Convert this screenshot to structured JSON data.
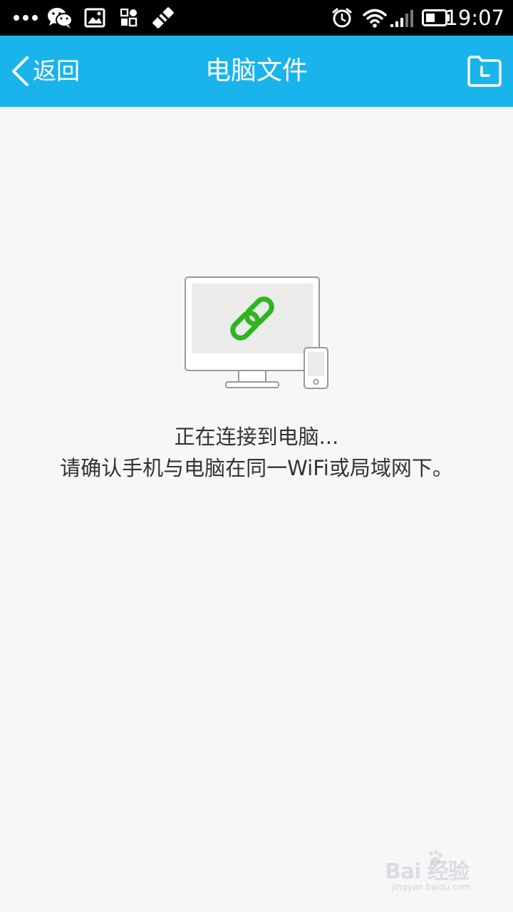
{
  "status_bar": {
    "time": "19:07",
    "icons": [
      "more-dots-icon",
      "wechat-icon",
      "gallery-icon",
      "app-grid-icon",
      "diagonal-bars-icon",
      "alarm-icon",
      "wifi-icon",
      "signal-icon",
      "battery-icon"
    ]
  },
  "nav": {
    "back_label": "返回",
    "title": "电脑文件",
    "back_icon": "chevron-left-icon",
    "right_icon": "folder-icon"
  },
  "main": {
    "illustration": "computer-phone-link-icon",
    "status_line1": "正在连接到电脑...",
    "status_line2": "请确认手机与电脑在同一WiFi或局域网下。"
  },
  "watermark": {
    "text": "Bai 经验",
    "url": "jingyan.baidu.com"
  },
  "colors": {
    "nav_bar": "#19b4ec",
    "background": "#f7f7f9",
    "link_icon": "#2db51f",
    "status_bar": "#000000"
  }
}
